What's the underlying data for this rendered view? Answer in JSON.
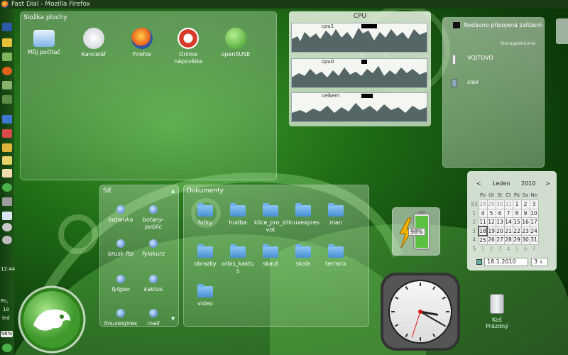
{
  "window": {
    "title": "Fast Dial - Mozilla Firefox"
  },
  "desktop_folder": {
    "title": "Složka plochy",
    "items": [
      {
        "label": "Můj počítač",
        "icon": "monitor-icon"
      },
      {
        "label": "Kancelář",
        "icon": "clock-icon"
      },
      {
        "label": "Firefox",
        "icon": "firefox-icon"
      },
      {
        "label": "Online\nnápověda",
        "icon": "help-lifebuoy-icon"
      },
      {
        "label": "openSUSE",
        "icon": "opensuse-icon"
      }
    ]
  },
  "cpu": {
    "title": "CPU",
    "graphs": [
      "cpu1",
      "cpu0",
      "celkem"
    ]
  },
  "devices": {
    "title": "Nedávno připojená zařízení:",
    "category": "StorageVolume",
    "items": [
      {
        "label": "VOJTOVO",
        "icon": "usb-drive-icon"
      },
      {
        "label": "slax",
        "icon": "usb-drive-icon"
      }
    ]
  },
  "network": {
    "title": "Síť",
    "items": [
      "botanika",
      "botany-public",
      "brusk-ftp",
      "fylokurz",
      "fytgeo",
      "kaktus",
      "linuxexpres",
      "mail"
    ]
  },
  "documents": {
    "title": "Dokumenty",
    "items": [
      "fotky",
      "hudba",
      "klice_pro_zivot",
      "linuxexpres",
      "man",
      "obrazky",
      "orbis_kaktus",
      "skaut",
      "skola",
      "terrarix",
      "video"
    ]
  },
  "battery": {
    "percent": "98%",
    "level": 0.98
  },
  "calendar": {
    "month": "Leden",
    "year": "2010",
    "weekdays": [
      "Po",
      "Út",
      "St",
      "Čt",
      "Pá",
      "So",
      "Ne"
    ],
    "weeks": [
      [
        "53",
        "28",
        "29",
        "30",
        "31",
        "1",
        "2",
        "3"
      ],
      [
        "1",
        "4",
        "5",
        "6",
        "7",
        "8",
        "9",
        "10"
      ],
      [
        "2",
        "11",
        "12",
        "13",
        "14",
        "15",
        "16",
        "17"
      ],
      [
        "3",
        "18",
        "19",
        "20",
        "21",
        "22",
        "23",
        "24"
      ],
      [
        "4",
        "25",
        "26",
        "27",
        "28",
        "29",
        "30",
        "31"
      ],
      [
        "5",
        "1",
        "2",
        "3",
        "4",
        "5",
        "6",
        "7"
      ]
    ],
    "date_value": "18.1.2010",
    "week_value": "3"
  },
  "clock_widget": {
    "hour": 3,
    "minute": 20,
    "second": 33
  },
  "trash": {
    "label": "Koš\nPrázdný"
  },
  "panel_left": {
    "time": "12:44",
    "date_day": "Po,",
    "date_num": "18",
    "date_month": "led",
    "battery": "98%"
  },
  "colors": {
    "accent": "#2f7f1f",
    "folder": "#5aa0e4"
  }
}
